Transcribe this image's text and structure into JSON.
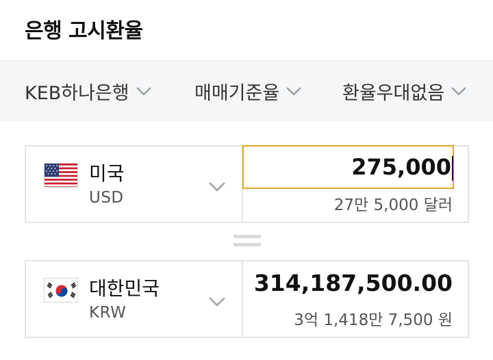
{
  "header": {
    "title": "은행 고시환율"
  },
  "filters": [
    {
      "label": "KEB하나은행",
      "icon": "chevron-down-icon"
    },
    {
      "label": "매매기준율",
      "icon": "chevron-down-icon"
    },
    {
      "label": "환율우대없음",
      "icon": "chevron-down-icon"
    }
  ],
  "from": {
    "country": "미국",
    "code": "USD",
    "flag_icon": "us-flag-icon",
    "amount": "275,000",
    "amount_words": "27만 5,000 달러"
  },
  "to": {
    "country": "대한민국",
    "code": "KRW",
    "flag_icon": "kr-flag-icon",
    "amount": "314,187,500.00",
    "amount_words": "3억 1,418만 7,500 원"
  },
  "colors": {
    "input_focus_border": "#e2a52b",
    "card_border": "#e3e5e8",
    "filter_bg": "#f5f6f8"
  }
}
